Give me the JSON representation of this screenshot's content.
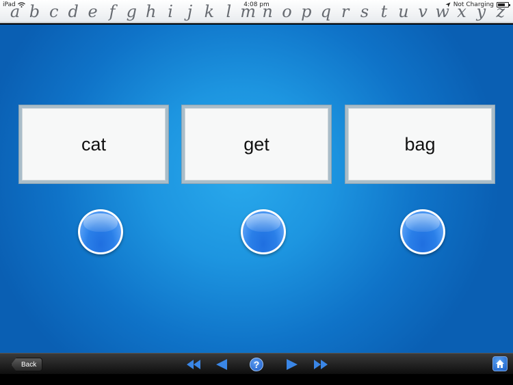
{
  "status_bar": {
    "device": "iPad",
    "time": "4:08 pm",
    "charging": "Not Charging"
  },
  "alphabet": [
    "a",
    "b",
    "c",
    "d",
    "e",
    "f",
    "g",
    "h",
    "i",
    "j",
    "k",
    "l",
    "m",
    "n",
    "o",
    "p",
    "q",
    "r",
    "s",
    "t",
    "u",
    "v",
    "w",
    "x",
    "y",
    "z"
  ],
  "word_cards": [
    {
      "word": "cat"
    },
    {
      "word": "get"
    },
    {
      "word": "bag"
    }
  ],
  "toolbar": {
    "back_label": "Back",
    "help_label": "?"
  },
  "colors": {
    "stage_blue": "#1d95e0",
    "button_blue": "#2a7fe8",
    "toolbar_dark": "#1e1e1e"
  }
}
